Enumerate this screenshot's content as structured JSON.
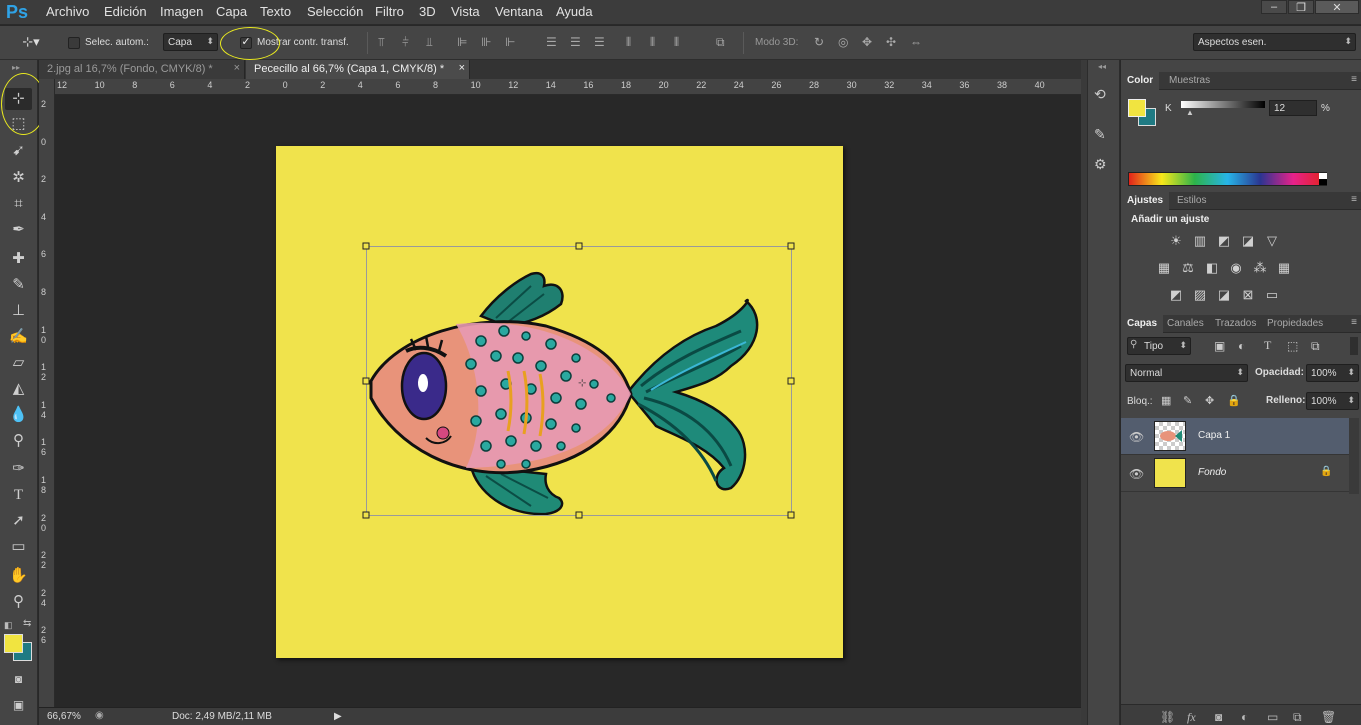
{
  "app": {
    "logo": "Ps",
    "menus": [
      "Archivo",
      "Edición",
      "Imagen",
      "Capa",
      "Texto",
      "Selección",
      "Filtro",
      "3D",
      "Vista",
      "Ventana",
      "Ayuda"
    ],
    "window_controls": [
      "–",
      "❐",
      "✕"
    ]
  },
  "options": {
    "auto_select_label": "Selec. autom.:",
    "auto_select_target": "Capa",
    "show_transform_label": "Mostrar contr. transf.",
    "mode3d_label": "Modo 3D:",
    "workspace": "Aspectos esen."
  },
  "tabs": [
    {
      "label": "2.jpg al 16,7% (Fondo, CMYK/8) *",
      "close": "×"
    },
    {
      "label": "Pececillo al 66,7% (Capa 1, CMYK/8) *",
      "close": "×"
    }
  ],
  "ruler_h": [
    "12",
    "10",
    "8",
    "6",
    "4",
    "2",
    "0",
    "2",
    "4",
    "6",
    "8",
    "10",
    "12",
    "14",
    "16",
    "18",
    "20",
    "22",
    "24",
    "26",
    "28",
    "30",
    "32",
    "34",
    "36",
    "38",
    "40"
  ],
  "ruler_v": [
    "2",
    "0",
    "2",
    "4",
    "6",
    "8",
    "10",
    "12",
    "14",
    "16",
    "18",
    "20",
    "22",
    "24",
    "26"
  ],
  "status": {
    "zoom": "66,67%",
    "doc": "Doc: 2,49 MB/2,11 MB"
  },
  "colors": {
    "foreground": "#f1e440",
    "background": "#1f7a83",
    "document": "#f0e34c",
    "highlight": "#e8e820"
  },
  "color_panel": {
    "tabs": [
      "Color",
      "Muestras"
    ],
    "channel": "K",
    "value": "12",
    "unit": "%"
  },
  "adjust_panel": {
    "tabs": [
      "Ajustes",
      "Estilos"
    ],
    "heading": "Añadir un ajuste"
  },
  "layers_panel": {
    "tabs": [
      "Capas",
      "Canales",
      "Trazados",
      "Propiedades"
    ],
    "filter": "Tipo",
    "blend_mode": "Normal",
    "opacity_label": "Opacidad:",
    "opacity": "100%",
    "lock_label": "Bloq.:",
    "fill_label": "Relleno:",
    "fill": "100%",
    "layers": [
      {
        "name": "Capa 1"
      },
      {
        "name": "Fondo"
      }
    ]
  }
}
